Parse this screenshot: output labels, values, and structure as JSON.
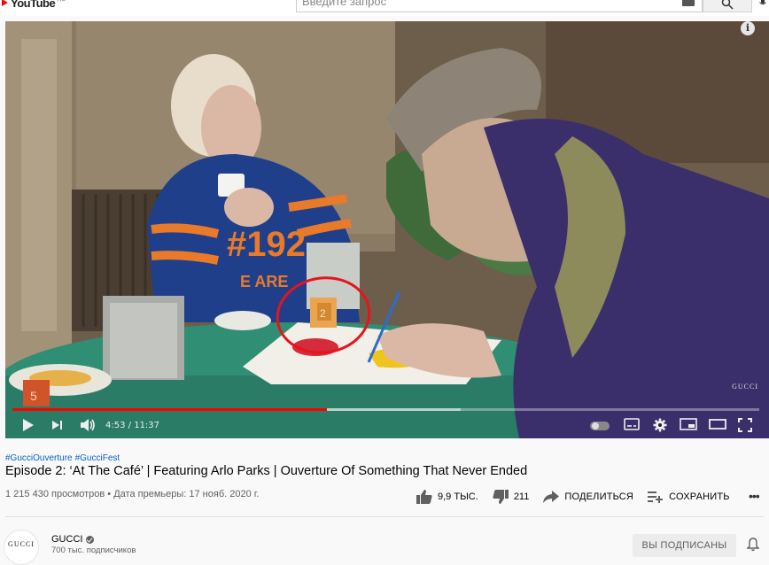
{
  "header": {
    "logo_text": "YouTube",
    "logo_region": "RU",
    "search_placeholder": "Введите запрос"
  },
  "player": {
    "current_time": "4:53",
    "separator": " / ",
    "duration": "11:37",
    "progress_fraction": 0.421,
    "buffered_fraction": 0.6,
    "watermark": "GUCCI",
    "info_label": "i",
    "accent_color": "#ff0000"
  },
  "video": {
    "hashtags": [
      "#GucciOuverture",
      "#GucciFest"
    ],
    "title": "Episode 2: ‘At The Café’ | Featuring Arlo Parks | Ouverture Of Something That Never Ended",
    "views": "1 215 430 просмотров",
    "bullet": " • ",
    "premiere": "Дата премьеры: 17 нояб. 2020 г.",
    "likes": "9,9 ТЫС.",
    "dislikes": "211",
    "share_label": "ПОДЕЛИТЬСЯ",
    "save_label": "СОХРАНИТЬ",
    "more_label": "•••"
  },
  "channel": {
    "avatar_text": "GUCCI",
    "name": "GUCCI",
    "subscribers": "700 тыс. подписчиков",
    "subscribe_label": "ВЫ ПОДПИСАНЫ"
  }
}
